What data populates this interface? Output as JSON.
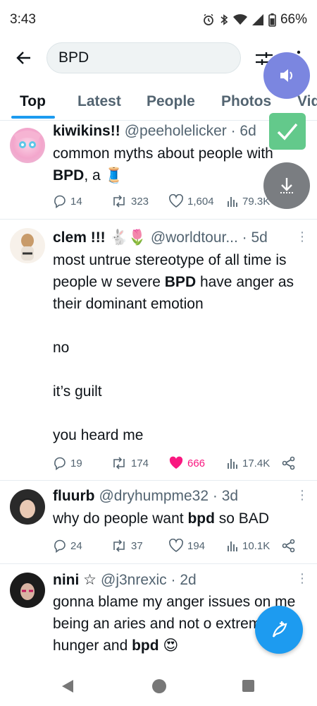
{
  "status_bar": {
    "time": "3:43",
    "battery": "66%"
  },
  "header": {
    "search_value": "BPD"
  },
  "tabs": [
    {
      "label": "Top"
    },
    {
      "label": "Latest"
    },
    {
      "label": "People"
    },
    {
      "label": "Photos"
    },
    {
      "label": "Vid"
    }
  ],
  "tweets": [
    {
      "name": "kiwikins!!",
      "handle": "@peeholelicker · 6d",
      "body_pre": "common myths about people with ",
      "body_bold": "BPD",
      "body_post": ", a 🧵",
      "replies": "14",
      "retweets": "323",
      "likes": "1,604",
      "views": "79.3K"
    },
    {
      "name": "clem !!! 🐇🌷",
      "handle": "@worldtour... · 5d",
      "body_line1_pre": "most untrue stereotype of all time is people w severe ",
      "body_bold": "BPD",
      "body_line1_post": " have anger as their dominant emotion",
      "body_p2": "no",
      "body_p3": "it’s guilt",
      "body_p4": "you heard me",
      "replies": "19",
      "retweets": "174",
      "likes": "666",
      "views": "17.4K"
    },
    {
      "name": "fluurb",
      "handle": "@dryhumpme32 · 3d",
      "body_pre": "why do people want ",
      "body_bold": "bpd",
      "body_post": " so BAD",
      "replies": "24",
      "retweets": "37",
      "likes": "194",
      "views": "10.1K"
    },
    {
      "name": "nini ☆",
      "handle": "@j3nrexic · 2d",
      "body_pre": "gonna blame my anger issues on me being an aries and not o",
      "body_mid": " extreme hunger and ",
      "body_bold": "bpd",
      "body_post": " 😍"
    }
  ],
  "icons": {
    "back": "arrow-left-icon",
    "filter": "filter-sliders-icon",
    "compose": "compose-feather-icon"
  },
  "colors": {
    "accent": "#1d9bf0",
    "liked": "#f91880"
  }
}
